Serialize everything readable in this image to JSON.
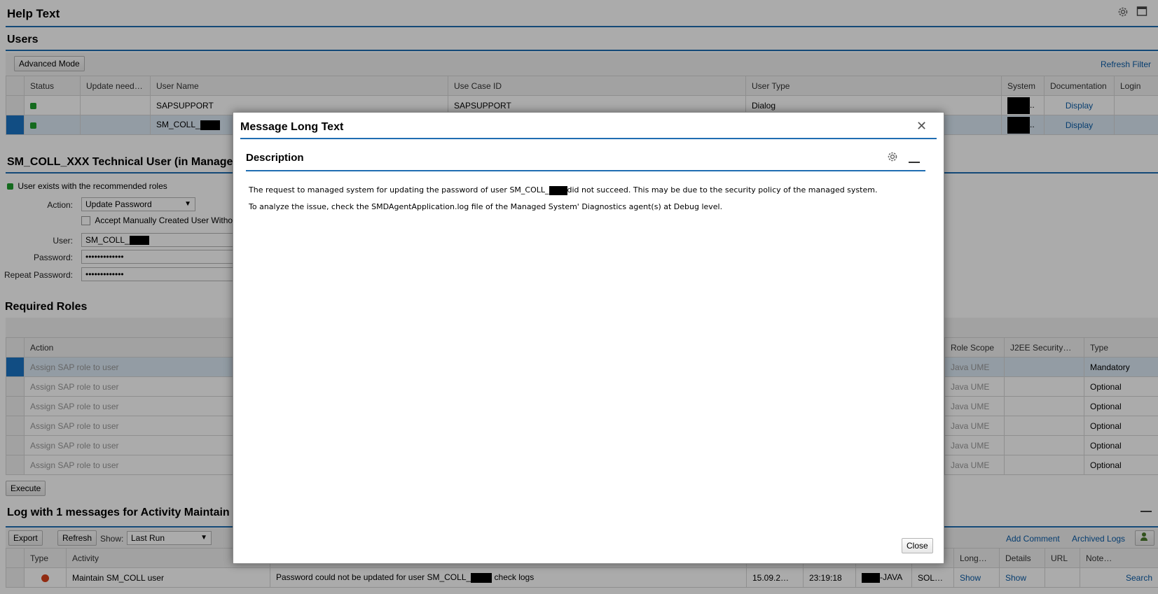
{
  "page": {
    "title": "Help Text"
  },
  "users": {
    "title": "Users",
    "advanced_mode": "Advanced Mode",
    "refresh_filter": "Refresh Filter",
    "columns": [
      "Status",
      "Update need…",
      "User Name",
      "Use Case ID",
      "User Type",
      "System",
      "Documentation",
      "Login"
    ],
    "rows": [
      {
        "user_name": "SAPSUPPORT",
        "use_case": "SAPSUPPORT",
        "user_type": "Dialog",
        "system_suffix": "..",
        "documentation": "Display"
      },
      {
        "user_name": "SM_COLL_",
        "use_case": "",
        "user_type": "",
        "system_suffix": "..",
        "documentation": "Display"
      }
    ]
  },
  "tech": {
    "title": "SM_COLL_XXX Technical User (in Manage",
    "status_text": "User  exists with the recommended roles",
    "action_label": "Action:",
    "action_value": "Update Password",
    "accept_label": "Accept Manually Created User Withou",
    "user_label": "User:",
    "user_value": "SM_COLL_",
    "password_label": "Password:",
    "password_value": "•••••••••••••",
    "repeat_label": "Repeat Password:",
    "repeat_value": "•••••••••••••"
  },
  "roles": {
    "title": "Required Roles",
    "columns": {
      "action": "Action",
      "scope": "Role Scope",
      "j2ee": "J2EE Security…",
      "type": "Type"
    },
    "rows": [
      {
        "action": "Assign SAP role to user",
        "scope": "Java UME",
        "type": "Mandatory"
      },
      {
        "action": "Assign SAP role to user",
        "scope": "Java UME",
        "type": "Optional"
      },
      {
        "action": "Assign SAP role to user",
        "scope": "Java UME",
        "type": "Optional"
      },
      {
        "action": "Assign SAP role to user",
        "scope": "Java UME",
        "type": "Optional"
      },
      {
        "action": "Assign SAP role to user",
        "scope": "Java UME",
        "type": "Optional"
      },
      {
        "action": "Assign SAP role to user",
        "scope": "Java UME",
        "type": "Optional"
      }
    ],
    "execute": "Execute"
  },
  "log": {
    "title": "Log with 1 messages for Activity Maintain",
    "export": "Export",
    "refresh": "Refresh",
    "show_label": "Show:",
    "show_value": "Last Run",
    "add_comment": "Add Comment",
    "archived_logs": "Archived Logs",
    "columns": {
      "type": "Type",
      "activity": "Activity",
      "long": "Long…",
      "details": "Details",
      "url": "URL",
      "note": "Note…"
    },
    "row": {
      "activity": "Maintain SM_COLL user",
      "message_a": "Password could not be updated for user SM_COLL_",
      "message_b": "check logs",
      "date": "15.09.2…",
      "time": "23:19:18",
      "system": "-JAVA",
      "solman": "SOLMA…",
      "long": "Show",
      "details": "Show",
      "note": "Search"
    }
  },
  "dialog": {
    "title": "Message Long Text",
    "section_title": "Description",
    "line1_a": "The request to managed system for updating the password of user SM_COLL_",
    "line1_b": "did not succeed. This may be due to the security policy of the managed system.",
    "line2": "To analyze the issue, check the SMDAgentApplication.log file of the Managed System' Diagnostics agent(s) at Debug level.",
    "close_button": "Close"
  },
  "colors": {
    "accent": "#1f6db2",
    "link": "#0a5ca8",
    "status_green": "#1e9e2e",
    "selected_row": "#dbe9f5"
  }
}
